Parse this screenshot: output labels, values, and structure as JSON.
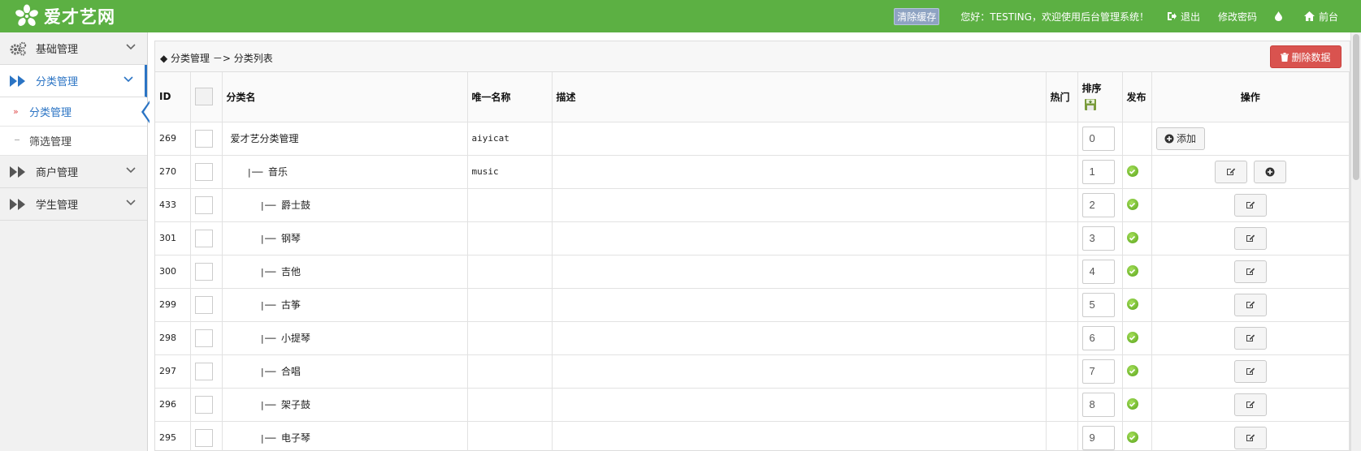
{
  "header": {
    "logo_text": "爱才艺网",
    "clear_cache": "清除缓存",
    "greeting": "您好：TESTING，欢迎使用后台管理系统！",
    "logout": "退出",
    "change_password": "修改密码",
    "front": "前台"
  },
  "sidebar": {
    "items": [
      {
        "label": "基础管理"
      },
      {
        "label": "分类管理"
      },
      {
        "label": "商户管理"
      },
      {
        "label": "学生管理"
      }
    ],
    "sub_items": [
      {
        "label": "分类管理"
      },
      {
        "label": "筛选管理"
      }
    ]
  },
  "breadcrumb": "◆ 分类管理 －> 分类列表",
  "delete_button": "删除数据",
  "table": {
    "headers": {
      "id": "ID",
      "name": "分类名",
      "unique": "唯一名称",
      "desc": "描述",
      "hot": "热门",
      "sort": "排序",
      "publish": "发布",
      "ops": "操作"
    },
    "add_label": "添加",
    "rows": [
      {
        "id": "269",
        "prefix": "",
        "name": "爱才艺分类管理",
        "unique": "aiyicat",
        "sort": "0"
      },
      {
        "id": "270",
        "prefix": "|── ",
        "name": "音乐",
        "unique": "music",
        "sort": "1"
      },
      {
        "id": "433",
        "prefix": "|── ",
        "name": "爵士鼓",
        "unique": "",
        "sort": "2"
      },
      {
        "id": "301",
        "prefix": "|── ",
        "name": "钢琴",
        "unique": "",
        "sort": "3"
      },
      {
        "id": "300",
        "prefix": "|── ",
        "name": "吉他",
        "unique": "",
        "sort": "4"
      },
      {
        "id": "299",
        "prefix": "|── ",
        "name": "古筝",
        "unique": "",
        "sort": "5"
      },
      {
        "id": "298",
        "prefix": "|── ",
        "name": "小提琴",
        "unique": "",
        "sort": "6"
      },
      {
        "id": "297",
        "prefix": "|── ",
        "name": "合唱",
        "unique": "",
        "sort": "7"
      },
      {
        "id": "296",
        "prefix": "|── ",
        "name": "架子鼓",
        "unique": "",
        "sort": "8"
      },
      {
        "id": "295",
        "prefix": "|── ",
        "name": "电子琴",
        "unique": "",
        "sort": "9"
      }
    ]
  },
  "colors": {
    "header_bg": "#5cb043",
    "accent": "#2b74c4",
    "danger": "#d9534f"
  }
}
